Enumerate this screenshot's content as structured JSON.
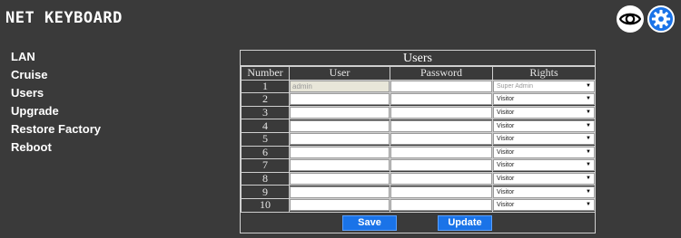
{
  "header": {
    "title": "NET KEYBOARD",
    "eye_icon": "eye-icon",
    "gear_icon": "gear-icon",
    "accent_color": "#1a73e8"
  },
  "sidebar": {
    "items": [
      {
        "label": "LAN"
      },
      {
        "label": "Cruise"
      },
      {
        "label": "Users"
      },
      {
        "label": "Upgrade"
      },
      {
        "label": "Restore Factory"
      },
      {
        "label": "Reboot"
      }
    ]
  },
  "users_panel": {
    "title": "Users",
    "columns": [
      "Number",
      "User",
      "Password",
      "Rights"
    ],
    "rows": [
      {
        "number": "1",
        "user": "admin",
        "password": "",
        "rights": "Super Admin"
      },
      {
        "number": "2",
        "user": "",
        "password": "",
        "rights": "Visitor"
      },
      {
        "number": "3",
        "user": "",
        "password": "",
        "rights": "Visitor"
      },
      {
        "number": "4",
        "user": "",
        "password": "",
        "rights": "Visitor"
      },
      {
        "number": "5",
        "user": "",
        "password": "",
        "rights": "Visitor"
      },
      {
        "number": "6",
        "user": "",
        "password": "",
        "rights": "Visitor"
      },
      {
        "number": "7",
        "user": "",
        "password": "",
        "rights": "Visitor"
      },
      {
        "number": "8",
        "user": "",
        "password": "",
        "rights": "Visitor"
      },
      {
        "number": "9",
        "user": "",
        "password": "",
        "rights": "Visitor"
      },
      {
        "number": "10",
        "user": "",
        "password": "",
        "rights": "Visitor"
      }
    ],
    "save_label": "Save",
    "update_label": "Update"
  }
}
